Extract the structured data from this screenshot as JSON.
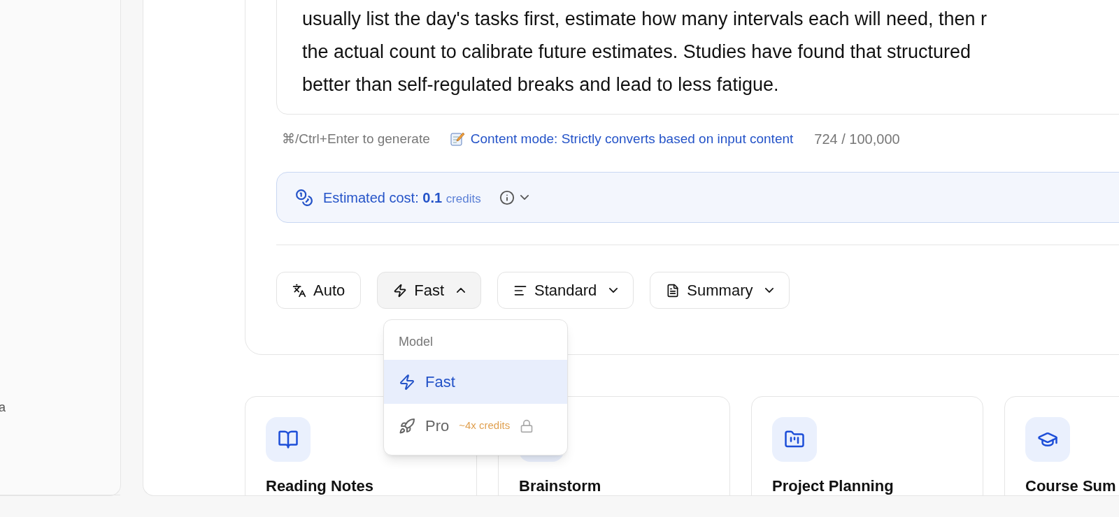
{
  "sidebar": {
    "items": [
      {
        "label": "a"
      }
    ]
  },
  "editor": {
    "text": "usually list the day's tasks first, estimate how many intervals each will need, then r\nthe actual count to calibrate future estimates. Studies have found that structured\nbetter than self-regulated breaks and lead to less fatigue.",
    "shortcut_hint": "⌘/Ctrl+Enter to generate",
    "mode_note": "Content mode: Strictly converts based on input content",
    "char_count": "724 / 100,000"
  },
  "cost": {
    "label": "Estimated cost:",
    "value": "0.1",
    "unit": "credits",
    "expanded": false
  },
  "toolbar": [
    {
      "kind": "language",
      "label": "Auto"
    },
    {
      "kind": "model",
      "label": "Fast",
      "expanded": true
    },
    {
      "kind": "length",
      "label": "Standard",
      "expanded": false
    },
    {
      "kind": "format",
      "label": "Summary",
      "expanded": false
    }
  ],
  "model_menu": {
    "header": "Model",
    "items": [
      {
        "kind": "fast",
        "label": "Fast",
        "selected": true
      },
      {
        "kind": "pro",
        "label": "Pro",
        "note": "~4x credits",
        "locked": true,
        "selected": false
      }
    ]
  },
  "templates": [
    {
      "kind": "book",
      "title": "Reading Notes"
    },
    {
      "kind": "idea",
      "title": "Brainstorm"
    },
    {
      "kind": "project",
      "title": "Project Planning"
    },
    {
      "kind": "course",
      "title": "Course Sum"
    }
  ]
}
